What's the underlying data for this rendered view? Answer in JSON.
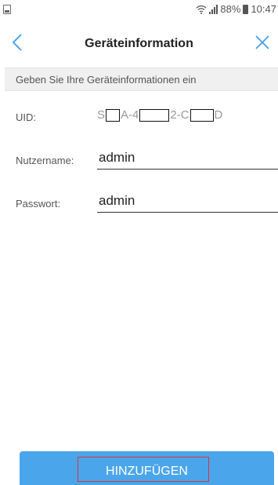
{
  "status_bar": {
    "battery": "88%",
    "time": "10:47"
  },
  "header": {
    "title": "Geräteinformation",
    "back_icon": "chevron-left-icon",
    "close_icon": "close-icon"
  },
  "info_bar": {
    "text": "Geben Sie Ihre Geräteinformationen ein"
  },
  "form": {
    "uid": {
      "label": "UID:",
      "segments": [
        "S",
        "A-4",
        "2-C",
        "D"
      ]
    },
    "username": {
      "label": "Nutzername:",
      "value": "admin"
    },
    "password": {
      "label": "Passwort:",
      "value": "admin"
    }
  },
  "add_button": {
    "label": "HINZUFÜGEN"
  },
  "colors": {
    "accent": "#4ba5ea",
    "highlight": "#d9363e"
  }
}
